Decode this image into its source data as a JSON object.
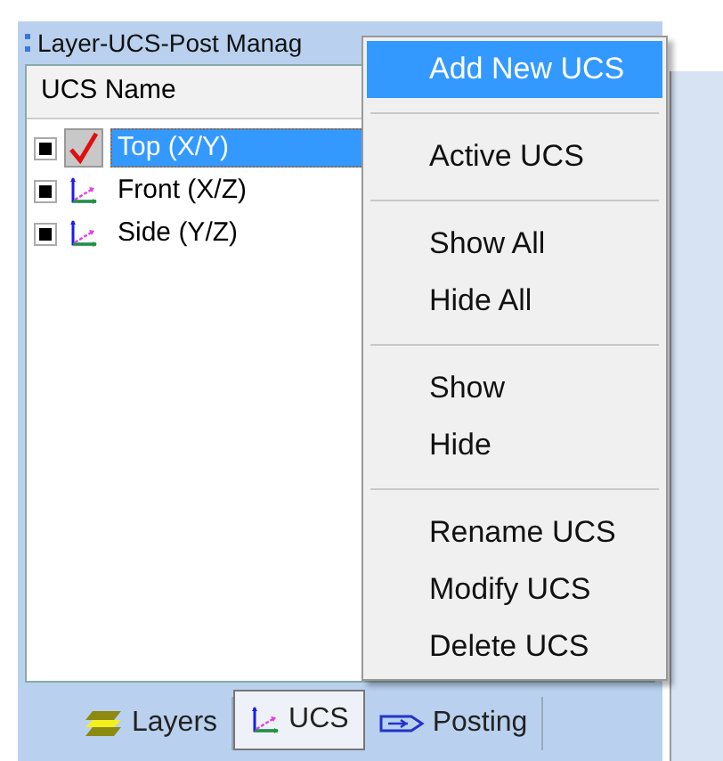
{
  "window": {
    "title": "Layer-UCS-Post Manag"
  },
  "list": {
    "column": "UCS Name",
    "rows": [
      {
        "name": "Top (X/Y)",
        "visible": true,
        "active": true,
        "selected": true
      },
      {
        "name": "Front (X/Z)",
        "visible": true,
        "active": false,
        "selected": false
      },
      {
        "name": "Side (Y/Z)",
        "visible": true,
        "active": false,
        "selected": false
      }
    ]
  },
  "context_menu": {
    "groups": [
      [
        {
          "label": "Add New UCS",
          "selected": true
        }
      ],
      [
        {
          "label": "Active UCS",
          "selected": false
        }
      ],
      [
        {
          "label": "Show All",
          "selected": false
        },
        {
          "label": "Hide All",
          "selected": false
        }
      ],
      [
        {
          "label": "Show",
          "selected": false
        },
        {
          "label": "Hide",
          "selected": false
        }
      ],
      [
        {
          "label": "Rename UCS",
          "selected": false
        },
        {
          "label": "Modify UCS",
          "selected": false
        },
        {
          "label": "Delete UCS",
          "selected": false
        }
      ]
    ]
  },
  "tabs": [
    {
      "kind": "layers",
      "label": "Layers",
      "selected": false
    },
    {
      "kind": "ucs",
      "label": "UCS",
      "selected": true
    },
    {
      "kind": "posting",
      "label": "Posting",
      "selected": false
    }
  ]
}
